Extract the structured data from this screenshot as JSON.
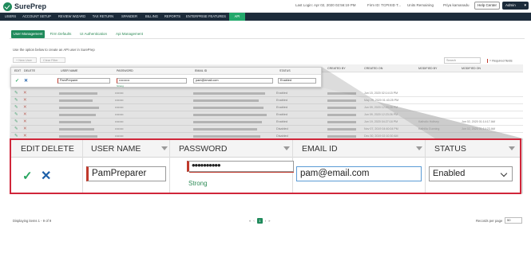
{
  "brand": {
    "name": "SurePrep",
    "color": "#1f8a5b",
    "nav_bg": "#1c2b3a",
    "highlight": "#d0263a"
  },
  "topbar": {
    "last_login": "Last Login: Apr 02, 2020 02:56:19 PM",
    "firm": "Firm ID: TCPIXID T...",
    "units": "Units Remaining",
    "user": "Priya kamanadu",
    "help_label": "Help Center",
    "admin_label": "Admin"
  },
  "nav": [
    "USERS",
    "ACCOUNT SETUP",
    "REVIEW WIZARD",
    "TAX RETURN",
    "SPANDER",
    "BILLING",
    "REPORTS",
    "ENTERPRISE FEATURES",
    "API"
  ],
  "subtabs": [
    "User Management",
    "Firm Defaults",
    "UI Authentication",
    "Api Management"
  ],
  "hint": "Use the option below to create an API user in SurePrep",
  "toolbar": {
    "new_user": "+ New User",
    "clear_filter": "Clear Filter",
    "search_placeholder": "Search",
    "required_note": "= Required fields"
  },
  "grid": {
    "headers": [
      "EDIT",
      "DELETE",
      "USER NAME",
      "PASSWORD",
      "EMAIL ID",
      "STATUS",
      "CREATED BY",
      "CREATED ON",
      "MODIFIED BY",
      "MODIFIED ON"
    ],
    "rows": [
      {
        "password": "••••••••",
        "status": "Enabled",
        "created_on": "Jun 15, 2020 02:14:15 PM",
        "modified_by": "",
        "modified_on": ""
      },
      {
        "password": "••••••••",
        "status": "Enabled",
        "created_on": "May 29, 2020 01:43:25 PM",
        "modified_by": "",
        "modified_on": ""
      },
      {
        "password": "••••••••",
        "status": "Enabled",
        "created_on": "Jun 09, 2020 12:20:28 PM",
        "modified_by": "",
        "modified_on": ""
      },
      {
        "password": "••••••••",
        "status": "Enabled",
        "created_on": "Jun 09, 2020 12:23:26 PM",
        "modified_by": "",
        "modified_on": ""
      },
      {
        "password": "••••••••",
        "status": "Enabled",
        "created_on": "Jun 19, 2020 04:27:18 PM",
        "modified_by": "Katholic Holtsey",
        "modified_on": "Jun 02, 2020 01:14:17 AM"
      },
      {
        "password": "••••••••",
        "status": "Disabled",
        "created_on": "Nov 07, 2019 04:40:04 PM",
        "modified_by": "Kathilla Gunning",
        "modified_on": "Jun 02, 2020 01:14:23 AM"
      },
      {
        "password": "••••••••",
        "status": "Disabled",
        "created_on": "Dec 30, 2019 02:10:30 AM",
        "modified_by": "",
        "modified_on": ""
      }
    ]
  },
  "edit_row": {
    "username": "PamPreparer",
    "password_mask": "••••••••••",
    "password_strength": "Strong",
    "email": "pam@email.com",
    "status": "Enabled"
  },
  "footer": {
    "displaying": "Displaying items 1 - 9 of 9",
    "current_page": "1",
    "records_label": "Records per page",
    "records_value": "50"
  }
}
